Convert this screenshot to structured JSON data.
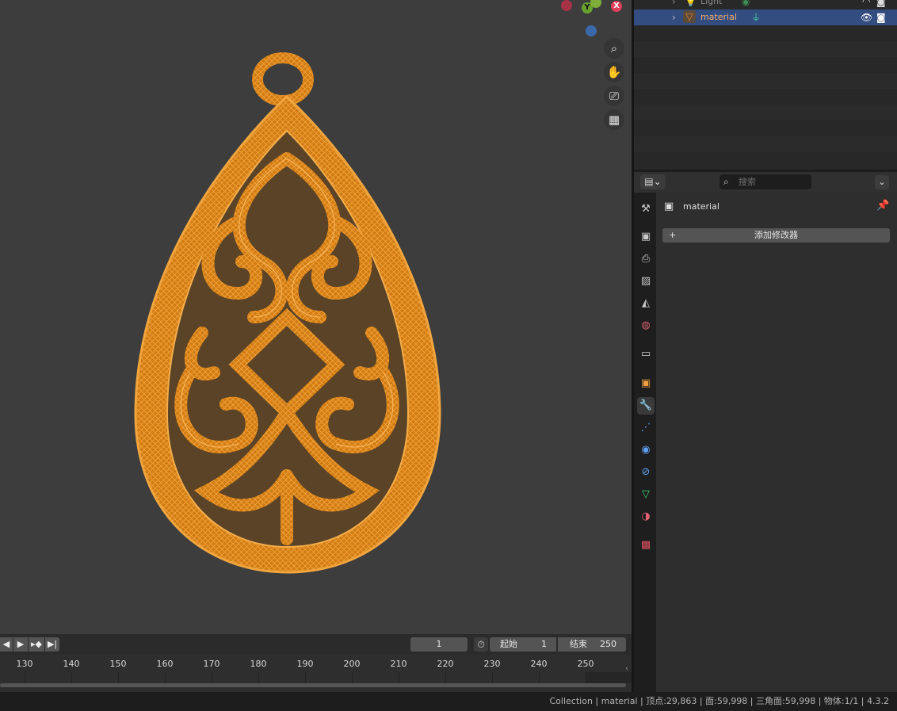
{
  "outliner": {
    "rows": [
      {
        "name": "Light"
      },
      {
        "name": "material"
      }
    ]
  },
  "properties": {
    "search_placeholder": "搜索",
    "object_name": "material",
    "add_modifier_label": "添加修改器",
    "tabs": [
      "tool",
      "render",
      "output",
      "view-layer",
      "scene",
      "world",
      "collection",
      "object",
      "modifiers",
      "particles",
      "physics",
      "constraints",
      "data",
      "material",
      "texture"
    ],
    "active_tab": "modifiers"
  },
  "timeline": {
    "current_frame": "1",
    "start_label": "起始",
    "start_value": "1",
    "end_label": "结束",
    "end_value": "250",
    "ticks": [
      "130",
      "140",
      "150",
      "160",
      "170",
      "180",
      "190",
      "200",
      "210",
      "220",
      "230",
      "240",
      "250"
    ]
  },
  "gizmo": {
    "x_label": "X",
    "y_label": "Y"
  },
  "status": {
    "text": "Collection | material | 顶点:29,863 | 面:59,998 | 三角面:59,998 | 物体:1/1 | 4.3.2"
  },
  "colors": {
    "accent_selected": "#334d80",
    "wireframe": "#e8901e",
    "viewport_bg": "#3d3d3d"
  }
}
